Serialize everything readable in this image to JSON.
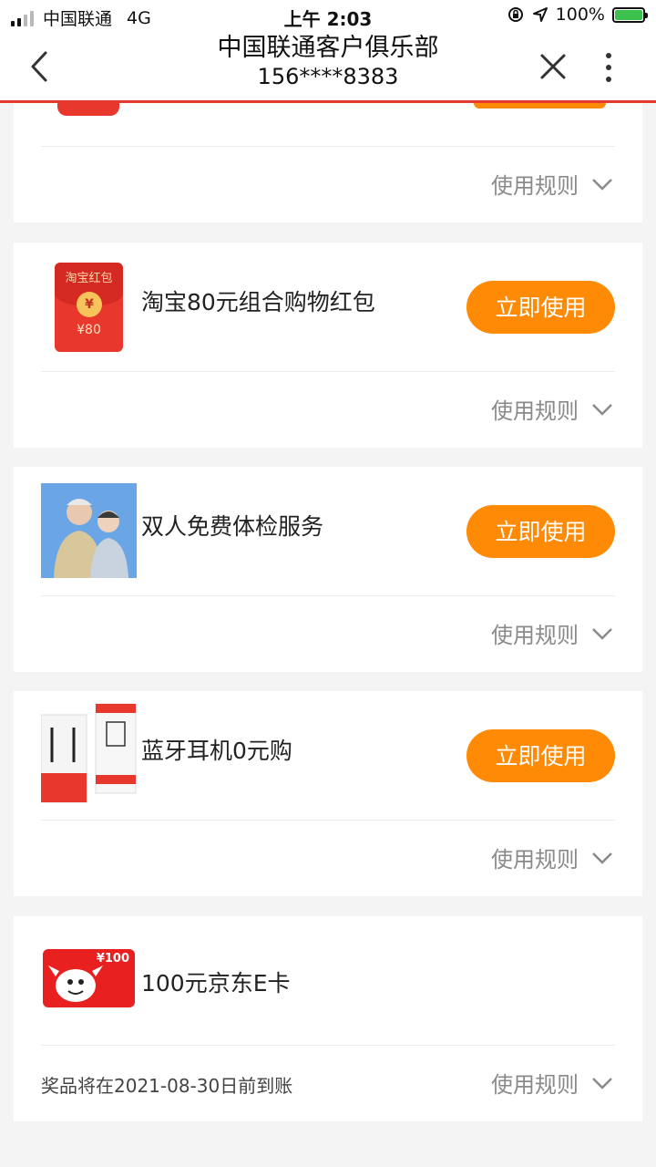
{
  "status_bar": {
    "carrier": "中国联通",
    "network": "4G",
    "time": "上午 2:03",
    "battery": "100%"
  },
  "nav": {
    "title": "中国联通客户俱乐部",
    "subtitle": "156****8383"
  },
  "rules_label": "使用规则",
  "use_label": "立即使用",
  "items": [
    {
      "name": "",
      "icon": "red-envelope"
    },
    {
      "name": "淘宝80元组合购物红包",
      "icon": "taobao-red-envelope",
      "icon_text": "淘宝红包",
      "icon_coin": "¥",
      "icon_amount": "¥80"
    },
    {
      "name": "双人免费体检服务",
      "icon": "elderly-couple-photo"
    },
    {
      "name": "蓝牙耳机0元购",
      "icon": "bluetooth-earphones-box"
    },
    {
      "name": "100元京东E卡",
      "icon": "jd-card",
      "icon_amount": "¥100",
      "note": "奖品将在2021-08-30日前到账"
    }
  ],
  "colors": {
    "accent": "#ff8a05",
    "nav_border": "#e63a2e",
    "background": "#f4f4f4"
  }
}
